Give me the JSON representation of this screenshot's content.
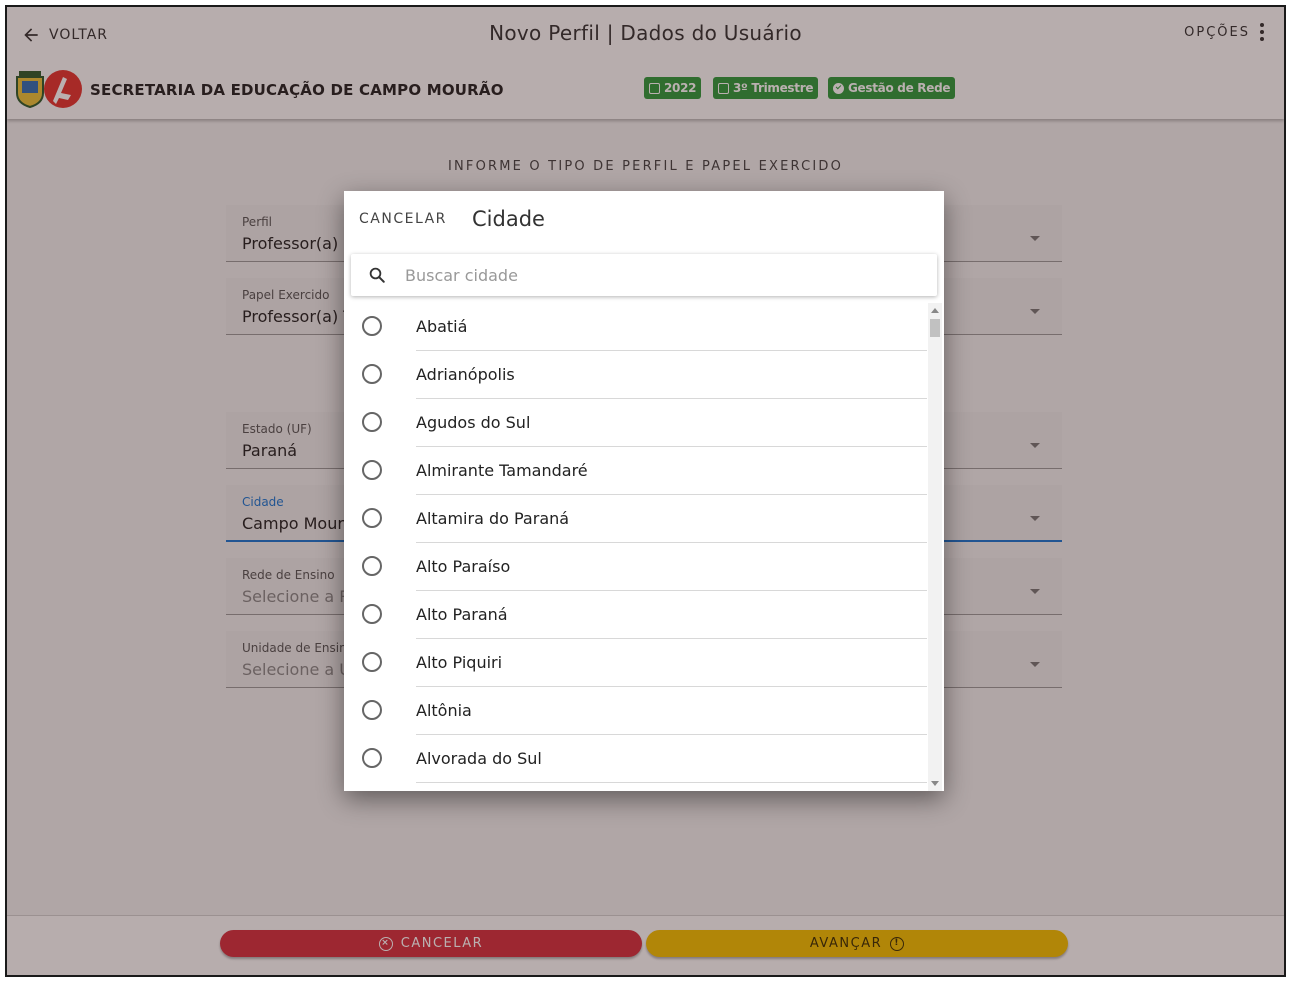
{
  "header": {
    "back_label": "VOLTAR",
    "title": "Novo Perfil | Dados do Usuário",
    "options_label": "OPÇÕES",
    "org_name": "SECRETARIA DA EDUCAÇÃO DE CAMPO MOURÃO",
    "chips": [
      {
        "label": "2022",
        "icon": "calendar-icon"
      },
      {
        "label": "3º Trimestre",
        "icon": "calendar-icon"
      },
      {
        "label": "Gestão de Rede",
        "icon": "check-circle-icon"
      }
    ]
  },
  "form": {
    "section_title": "INFORME O TIPO DE PERFIL E PAPEL EXERCIDO",
    "fields": [
      {
        "label": "Perfil",
        "value": "Professor(a)"
      },
      {
        "label": "Papel Exercido",
        "value": "Professor(a) T"
      },
      {
        "label": "Estado (UF)",
        "value": "Paraná"
      },
      {
        "label": "Cidade",
        "value": "Campo Mourã"
      },
      {
        "label": "Rede de Ensino",
        "value": "Selecione a R"
      },
      {
        "label": "Unidade de Ensin",
        "value": "Selecione a U"
      }
    ]
  },
  "footer": {
    "cancel_label": "CANCELAR",
    "next_label": "AVANÇAR"
  },
  "dialog": {
    "cancel_label": "CANCELAR",
    "title": "Cidade",
    "search_placeholder": "Buscar cidade",
    "search_value": "",
    "cities": [
      "Abatiá",
      "Adrianópolis",
      "Agudos do Sul",
      "Almirante Tamandaré",
      "Altamira do Paraná",
      "Alto Paraíso",
      "Alto Paraná",
      "Alto Piquiri",
      "Altônia",
      "Alvorada do Sul"
    ]
  },
  "colors": {
    "chip_green": "#2e9a3c",
    "cancel_red": "#d32f3f",
    "next_yellow": "#f2bf00",
    "focus_blue": "#1976d2"
  }
}
